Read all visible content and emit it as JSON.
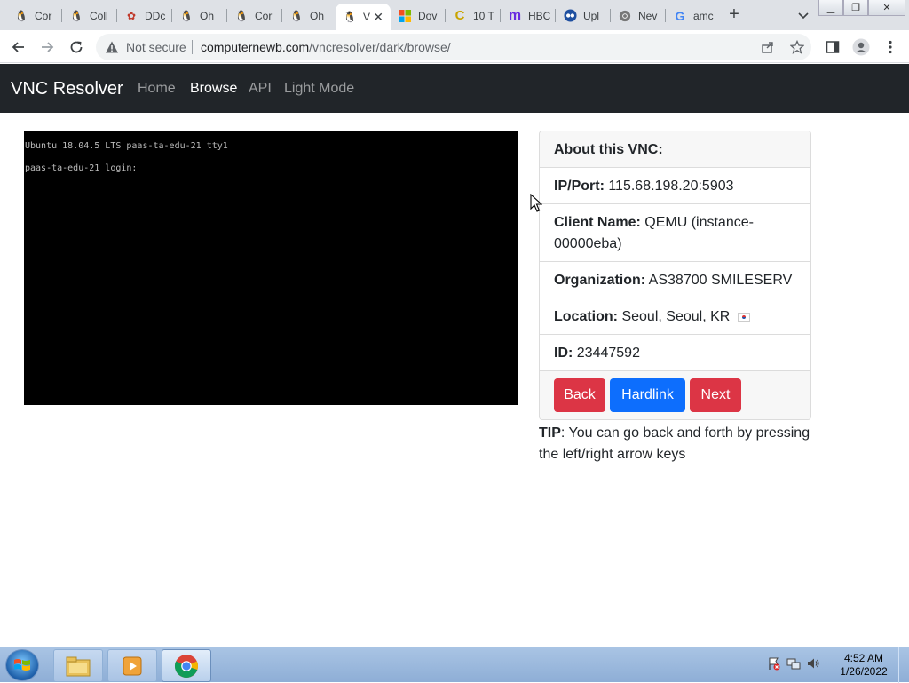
{
  "browser": {
    "tabs": [
      {
        "title": "Cor",
        "icon": "vnc-logo-icon"
      },
      {
        "title": "Coll",
        "icon": "vnc-logo-icon"
      },
      {
        "title": "DDc",
        "icon": "flower-icon"
      },
      {
        "title": "Oh",
        "icon": "vnc-logo-icon"
      },
      {
        "title": "Cor",
        "icon": "vnc-logo-icon"
      },
      {
        "title": "Oh",
        "icon": "vnc-logo-icon"
      },
      {
        "title": "V",
        "icon": "vnc-logo-icon",
        "active": true
      },
      {
        "title": "Dov",
        "icon": "microsoft-icon"
      },
      {
        "title": "10 T",
        "icon": "c-logo-icon"
      },
      {
        "title": "HBC",
        "icon": "m-logo-icon"
      },
      {
        "title": "Upl",
        "icon": "upload-site-icon"
      },
      {
        "title": "Nev",
        "icon": "chrome-gray-icon"
      },
      {
        "title": "amc",
        "icon": "google-icon"
      }
    ],
    "security_label": "Not secure",
    "url_host": "computernewb.com",
    "url_path": "/vncresolver/dark/browse/"
  },
  "site": {
    "brand": "VNC Resolver",
    "nav": [
      {
        "label": "Home",
        "active": false
      },
      {
        "label": "Browse",
        "active": true
      },
      {
        "label": "API",
        "active": false
      },
      {
        "label": "Light Mode",
        "active": false
      }
    ]
  },
  "vnc_screen": {
    "lines": [
      "Ubuntu 18.04.5 LTS paas-ta-edu-21 tty1",
      "paas-ta-edu-21 login:"
    ]
  },
  "about": {
    "title": "About this VNC:",
    "ip_label": "IP/Port:",
    "ip_value": "115.68.198.20:5903",
    "client_label": "Client Name:",
    "client_value": "QEMU (instance-00000eba)",
    "org_label": "Organization:",
    "org_value": "AS38700 SMILESERV",
    "location_label": "Location:",
    "location_value": "Seoul, Seoul, KR",
    "id_label": "ID:",
    "id_value": "23447592",
    "buttons": {
      "back": "Back",
      "hardlink": "Hardlink",
      "next": "Next"
    }
  },
  "tip": {
    "label": "TIP",
    "text": ": You can go back and forth by pressing the left/right arrow keys"
  },
  "taskbar": {
    "time": "4:52 AM",
    "date": "1/26/2022"
  },
  "colors": {
    "navbar": "#212529",
    "btn_red": "#dc3545",
    "btn_blue": "#0d6efd"
  }
}
